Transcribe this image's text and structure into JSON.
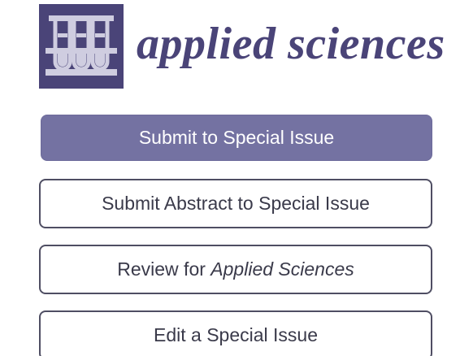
{
  "header": {
    "logo_icon": "test-tubes-icon",
    "journal_title": "applied sciences",
    "brand_color": "#4a4478"
  },
  "actions": {
    "submit_label": "Submit to Special Issue",
    "submit_abstract_label": "Submit Abstract to Special Issue",
    "review_prefix": "Review for ",
    "review_journal": "Applied Sciences",
    "edit_label": "Edit a Special Issue",
    "primary_color": "#7472a2"
  }
}
